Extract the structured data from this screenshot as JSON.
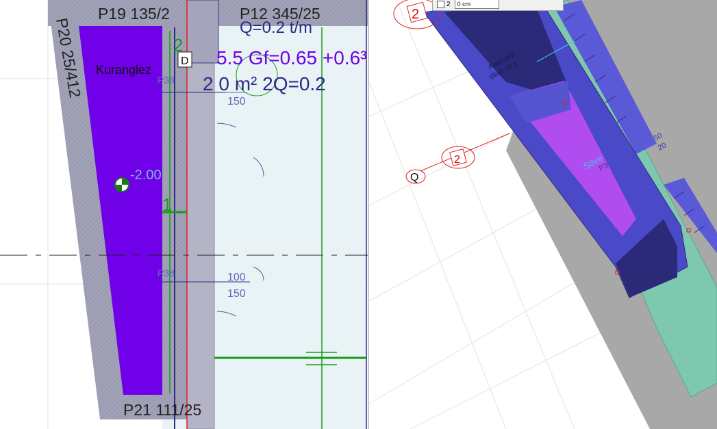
{
  "plan": {
    "labels": {
      "p19": "P19 135/2",
      "p12": "P12  345/25",
      "p20": "P20  25/412",
      "p21": "P21 111/25",
      "room_name": "Kuranglez",
      "elevation": "-2.00",
      "marker_2": "2",
      "marker_1": "1",
      "load_top": "Q=0.2 t/m",
      "overlap_1": "5.5 Gf=0.65 +0.6³",
      "overlap_2": "2 0 m² 2Q=0.2",
      "p38_top": "P38",
      "p38_bottom": "P38",
      "dim_150_top": "150",
      "dim_100": "100",
      "dim_150_bottom": "150",
      "box_d": "D"
    },
    "colors": {
      "room_fill": "#7000e8",
      "wall_fill": "#9a9ab0",
      "hatch_bg": "#e9f3f6",
      "green_line": "#1a9a1a",
      "red_line": "#e02020",
      "navy_line": "#2a2a8a"
    }
  },
  "model": {
    "labels": {
      "marker_top": "2",
      "marker_mid": "2",
      "axis_q": "Q",
      "aspirator": "Aspiratör",
      "aspirator_sub": "tilli@ +0.4",
      "sove": "Söve",
      "p3": "P3",
      "dim_50": "50",
      "dim_20": "20"
    },
    "dialog": {
      "checkbox_label": "2",
      "field_value": "0 cm"
    },
    "colors": {
      "channel_outer": "#4a4ac8",
      "channel_dark": "#2a2a78",
      "slab_fill": "#b04cf0",
      "floor_gray": "#a8a8a8",
      "wall_green": "#7ec8b0"
    }
  }
}
